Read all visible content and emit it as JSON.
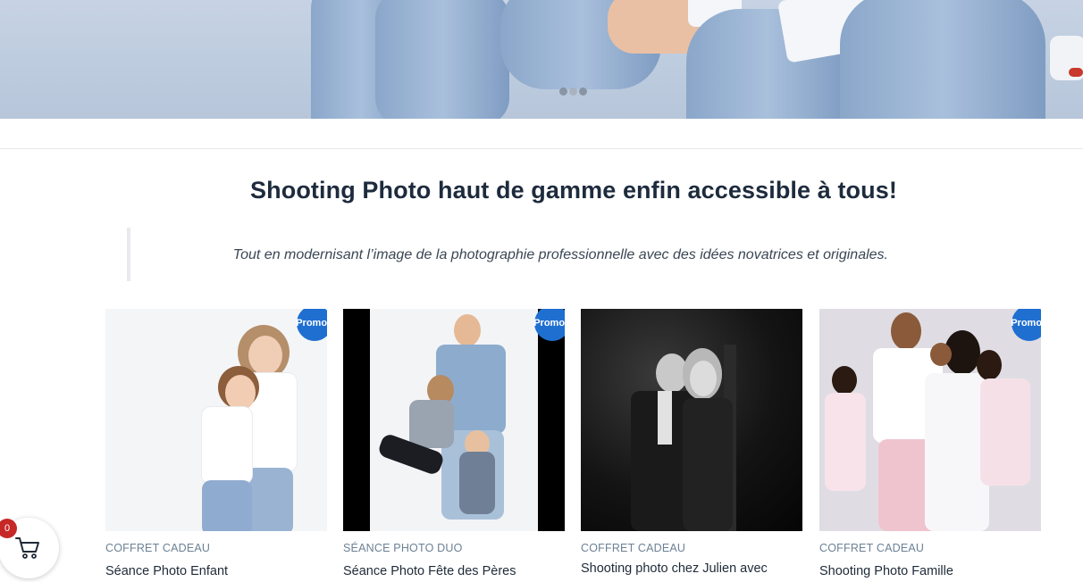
{
  "hero": {
    "slider_dots": [
      "slide-1",
      "slide-2",
      "slide-3"
    ],
    "active_dot": 1
  },
  "headline": "Shooting Photo haut de gamme enfin accessible à tous!",
  "tagline": "Tout en modernisant l’image de la photographie professionnelle avec des idées novatrices et originales.",
  "products": [
    {
      "category": "COFFRET CADEAU",
      "title": "Séance Photo Enfant",
      "promo": "Promo !"
    },
    {
      "category": "SÉANCE PHOTO DUO",
      "title": "Séance Photo Fête des Pères",
      "promo": "Promo !"
    },
    {
      "category": "COFFRET CADEAU",
      "title": "Shooting photo chez Julien avec",
      "promo": ""
    },
    {
      "category": "COFFRET CADEAU",
      "title": "Shooting Photo Famille",
      "promo": "Promo !"
    }
  ],
  "cart": {
    "count": "0",
    "icon": "cart-icon"
  },
  "colors": {
    "promo": "#1f6fd1",
    "badge": "#c62828",
    "headline": "#1d2b3d"
  }
}
